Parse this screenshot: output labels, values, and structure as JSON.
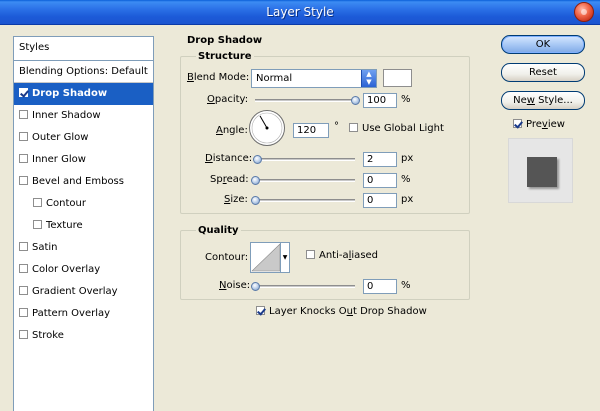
{
  "window": {
    "title": "Layer Style"
  },
  "styles_panel": {
    "header": "Styles",
    "items": [
      {
        "label": "Blending Options: Default",
        "checkbox": false,
        "checked": false,
        "selected": false,
        "indent": false
      },
      {
        "label": "Drop Shadow",
        "checkbox": true,
        "checked": true,
        "selected": true,
        "indent": false
      },
      {
        "label": "Inner Shadow",
        "checkbox": true,
        "checked": false,
        "selected": false,
        "indent": false
      },
      {
        "label": "Outer Glow",
        "checkbox": true,
        "checked": false,
        "selected": false,
        "indent": false
      },
      {
        "label": "Inner Glow",
        "checkbox": true,
        "checked": false,
        "selected": false,
        "indent": false
      },
      {
        "label": "Bevel and Emboss",
        "checkbox": true,
        "checked": false,
        "selected": false,
        "indent": false
      },
      {
        "label": "Contour",
        "checkbox": true,
        "checked": false,
        "selected": false,
        "indent": true
      },
      {
        "label": "Texture",
        "checkbox": true,
        "checked": false,
        "selected": false,
        "indent": true
      },
      {
        "label": "Satin",
        "checkbox": true,
        "checked": false,
        "selected": false,
        "indent": false
      },
      {
        "label": "Color Overlay",
        "checkbox": true,
        "checked": false,
        "selected": false,
        "indent": false
      },
      {
        "label": "Gradient Overlay",
        "checkbox": true,
        "checked": false,
        "selected": false,
        "indent": false
      },
      {
        "label": "Pattern Overlay",
        "checkbox": true,
        "checked": false,
        "selected": false,
        "indent": false
      },
      {
        "label": "Stroke",
        "checkbox": true,
        "checked": false,
        "selected": false,
        "indent": false
      }
    ]
  },
  "drop_shadow": {
    "section_title": "Drop Shadow",
    "structure": {
      "title": "Structure",
      "blend_mode": {
        "label": "Blend Mode:",
        "value": "Normal"
      },
      "opacity": {
        "label": "Opacity:",
        "value": "100",
        "unit": "%",
        "fraction": 1.0
      },
      "angle": {
        "label": "Angle:",
        "value": "120",
        "unit": "°",
        "degrees": 120
      },
      "use_global_light": {
        "label": "Use Global Light",
        "checked": false
      },
      "distance": {
        "label": "Distance:",
        "value": "2",
        "unit": "px",
        "fraction": 0.02
      },
      "spread": {
        "label": "Spread:",
        "value": "0",
        "unit": "%",
        "fraction": 0
      },
      "size": {
        "label": "Size:",
        "value": "0",
        "unit": "px",
        "fraction": 0
      }
    },
    "quality": {
      "title": "Quality",
      "contour": {
        "label": "Contour:"
      },
      "anti_aliased": {
        "label": "Anti-aliased",
        "checked": false
      },
      "noise": {
        "label": "Noise:",
        "value": "0",
        "unit": "%",
        "fraction": 0
      }
    },
    "layer_knocks_out": {
      "label": "Layer Knocks Out Drop Shadow",
      "checked": true
    }
  },
  "buttons": {
    "ok": "OK",
    "reset": "Reset",
    "new_style": "New Style...",
    "preview": {
      "label": "Preview",
      "checked": true
    }
  },
  "icons": {
    "close": "close-icon",
    "dropdown": "dropdown-arrow-icon",
    "checkbox": "checkbox-icon"
  },
  "colors": {
    "titlebar": "#1c5ad8",
    "selection": "#1a5fc4",
    "shadow_color": "#ffffff",
    "preview_square": "#555555"
  }
}
